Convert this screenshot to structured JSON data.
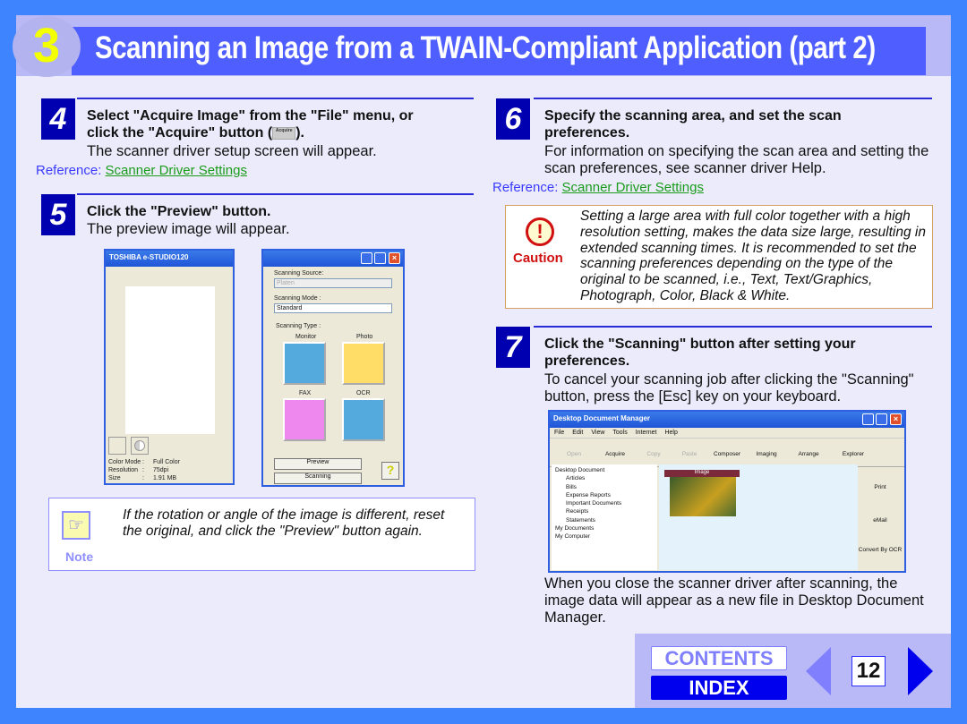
{
  "header": {
    "chapter": "3",
    "title": "Scanning an Image from a TWAIN-Compliant Application (part 2)"
  },
  "steps": [
    {
      "num": "4",
      "heading_line1": "Select \"Acquire Image\" from the \"File\" menu, or",
      "heading_line2_pre": "click the \"Acquire\" button (",
      "heading_line2_post": ").",
      "acquire_icon_label": "Acquire",
      "body": "The scanner driver setup screen will appear.",
      "ref_label": "Reference:",
      "ref_link": "Scanner Driver Settings"
    },
    {
      "num": "5",
      "heading": "Click the \"Preview\" button.",
      "body": "The preview image will appear."
    },
    {
      "num": "6",
      "heading": "Specify the scanning area, and set the scan preferences.",
      "body": "For information on specifying the scan area and setting the scan preferences, see scanner driver Help.",
      "ref_label": "Reference:",
      "ref_link": "Scanner Driver Settings"
    },
    {
      "num": "7",
      "heading": "Click the \"Scanning\" button after setting your preferences.",
      "body": "To cancel your scanning job after clicking the \"Scanning\" button, press the [Esc] key on your keyboard.",
      "after": "When you close the scanner driver after scanning, the image data will appear as a new file in Desktop Document Manager."
    }
  ],
  "preview_window": {
    "title": "TOSHIBA e-STUDIO120",
    "info": [
      [
        "Color Mode",
        ":",
        "Full Color"
      ],
      [
        "Resolution",
        ":",
        "75dpi"
      ],
      [
        "Size",
        ":",
        "1.91 MB"
      ]
    ]
  },
  "settings_window": {
    "source_label": "Scanning Source:",
    "source_value": "Platen",
    "mode_label": "Scanning Mode :",
    "mode_value": "Standard",
    "type_label": "Scanning Type :",
    "types": [
      "Monitor",
      "Photo",
      "FAX",
      "OCR"
    ],
    "preview_btn": "Preview",
    "scanning_btn": "Scanning",
    "help_btn": "?"
  },
  "ddm_window": {
    "title": "Desktop Document Manager",
    "menu": [
      "File",
      "Edit",
      "View",
      "Tools",
      "Internet",
      "Help"
    ],
    "toolbar": [
      "Open",
      "Acquire",
      "Copy",
      "Paste",
      "Composer",
      "Imaging",
      "Arrange",
      "Explorer"
    ],
    "tree": [
      "Desktop Document",
      "Articles",
      "Bills",
      "Expense Reports",
      "Important Documents",
      "Receipts",
      "Statements",
      "My Documents",
      "My Computer"
    ],
    "image_label": "Image",
    "side": [
      "Print",
      "eMail",
      "Convert By OCR"
    ]
  },
  "caution": {
    "label": "Caution",
    "text": "Setting a large area with full color together with a high resolution setting, makes the data size large, resulting in extended scanning times. It is recommended to set the scanning preferences depending on the type of the original to be scanned, i.e., Text, Text/Graphics, Photograph, Color, Black & White."
  },
  "note": {
    "label": "Note",
    "text": "If the rotation or angle of the image is different, reset the original, and click the \"Preview\" button again."
  },
  "nav": {
    "contents": "CONTENTS",
    "index": "INDEX",
    "page": "12"
  },
  "colors": {
    "title_bar": "#4f5fff",
    "step_box": "#0000b0",
    "link": "#1a9c1a",
    "caution": "#d01010",
    "index_bg": "#0000ee"
  }
}
